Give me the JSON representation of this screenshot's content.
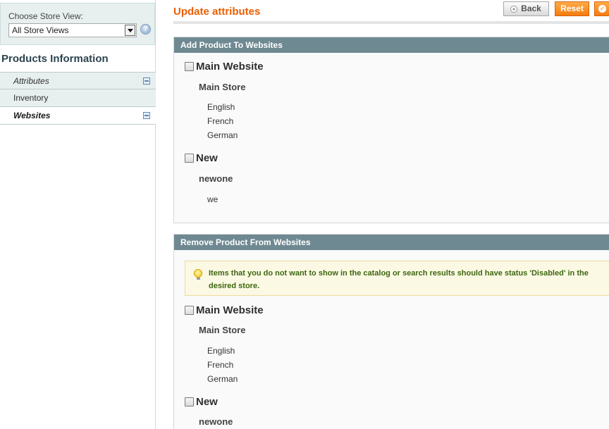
{
  "store_switcher": {
    "label": "Choose Store View:",
    "selected": "All Store Views"
  },
  "sidebar": {
    "title": "Products Information",
    "tabs": [
      {
        "label": "Attributes",
        "changed": true
      },
      {
        "label": "Inventory",
        "changed": false
      },
      {
        "label": "Websites",
        "changed": true,
        "active": true
      }
    ]
  },
  "header": {
    "title": "Update attributes",
    "buttons": {
      "back": "Back",
      "reset": "Reset"
    }
  },
  "add_section": {
    "title": "Add Product To Websites",
    "websites": [
      {
        "name": "Main Website",
        "checked": false,
        "store": "Main Store",
        "views": [
          "English",
          "French",
          "German"
        ]
      },
      {
        "name": "New",
        "checked": false,
        "store": "newone",
        "views": [
          "we"
        ]
      }
    ]
  },
  "remove_section": {
    "title": "Remove Product From Websites",
    "notice": "Items that you do not want to show in the catalog or search results should have status 'Disabled' in the desired store.",
    "websites": [
      {
        "name": "Main Website",
        "checked": false,
        "store": "Main Store",
        "views": [
          "English",
          "French",
          "German"
        ]
      },
      {
        "name": "New",
        "checked": false,
        "store": "newone",
        "views": []
      }
    ]
  },
  "colors": {
    "accent": "#eb5e00",
    "section_header": "#6f8992",
    "button_orange": "#f37b0f",
    "notice_text": "#3d6611"
  },
  "icons": [
    "help-icon",
    "dropdown-arrow-icon",
    "changed-icon",
    "back-icon",
    "save-icon",
    "bulb-icon"
  ]
}
